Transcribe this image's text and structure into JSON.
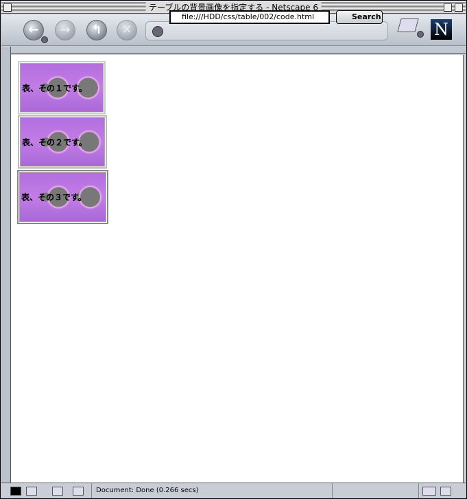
{
  "window": {
    "title": "テーブルの背景画像を指定する - Netscape 6"
  },
  "toolbar": {
    "back": "back",
    "forward": "forward",
    "reload": "reload",
    "stop": "stop",
    "url": "file:///HDD/css/table/002/code.html",
    "search_label": "Search",
    "logo": "N"
  },
  "tables": [
    {
      "text": "表、その１です。"
    },
    {
      "text": "表、その２です。"
    },
    {
      "text": "表、その３です。"
    }
  ],
  "status": {
    "text": "Document: Done (0.266 secs)"
  }
}
